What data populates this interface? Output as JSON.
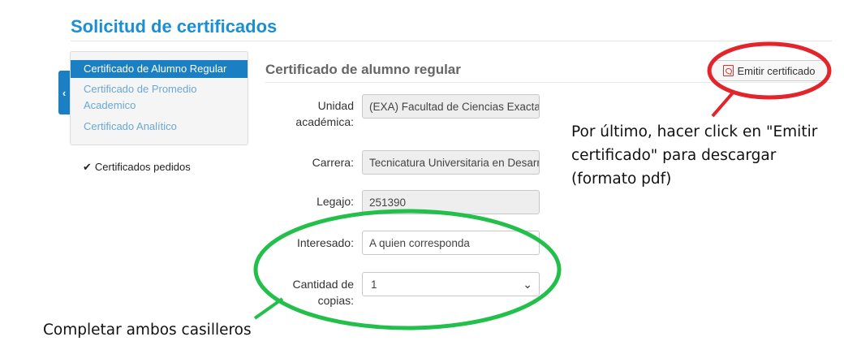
{
  "header": {
    "title": "Solicitud de certificados"
  },
  "sidebar": {
    "collapse_glyph": "‹",
    "items": [
      {
        "label": "Certificado de Alumno Regular",
        "active": true
      },
      {
        "label": "Certificado de Promedio Academico",
        "active": false
      },
      {
        "label": "Certificado Analítico",
        "active": false
      }
    ],
    "pedidos": {
      "check_glyph": "✔",
      "label": "Certificados pedidos"
    }
  },
  "form": {
    "title": "Certificado de alumno regular",
    "emit_button": {
      "label": "Emitir certificado",
      "icon": "pdf-icon"
    },
    "fields": {
      "unidad": {
        "label": "Unidad académica:",
        "value": "(EXA) Facultad de Ciencias Exactas"
      },
      "carrera": {
        "label": "Carrera:",
        "value": "Tecnicatura Universitaria en Desarrollo"
      },
      "legajo": {
        "label": "Legajo:",
        "value": "251390"
      },
      "interesado": {
        "label": "Interesado:",
        "value": "A quien corresponda"
      },
      "cantidad": {
        "label": "Cantidad de copias:",
        "value": "1"
      }
    }
  },
  "annotations": {
    "emit_note": "Por último, hacer click en \"Emitir certificado\" para descargar (formato pdf)",
    "fill_note": "Completar ambos casilleros",
    "colors": {
      "red": "#e3242b",
      "green": "#22c04a",
      "accent": "#1b7fc4"
    }
  }
}
